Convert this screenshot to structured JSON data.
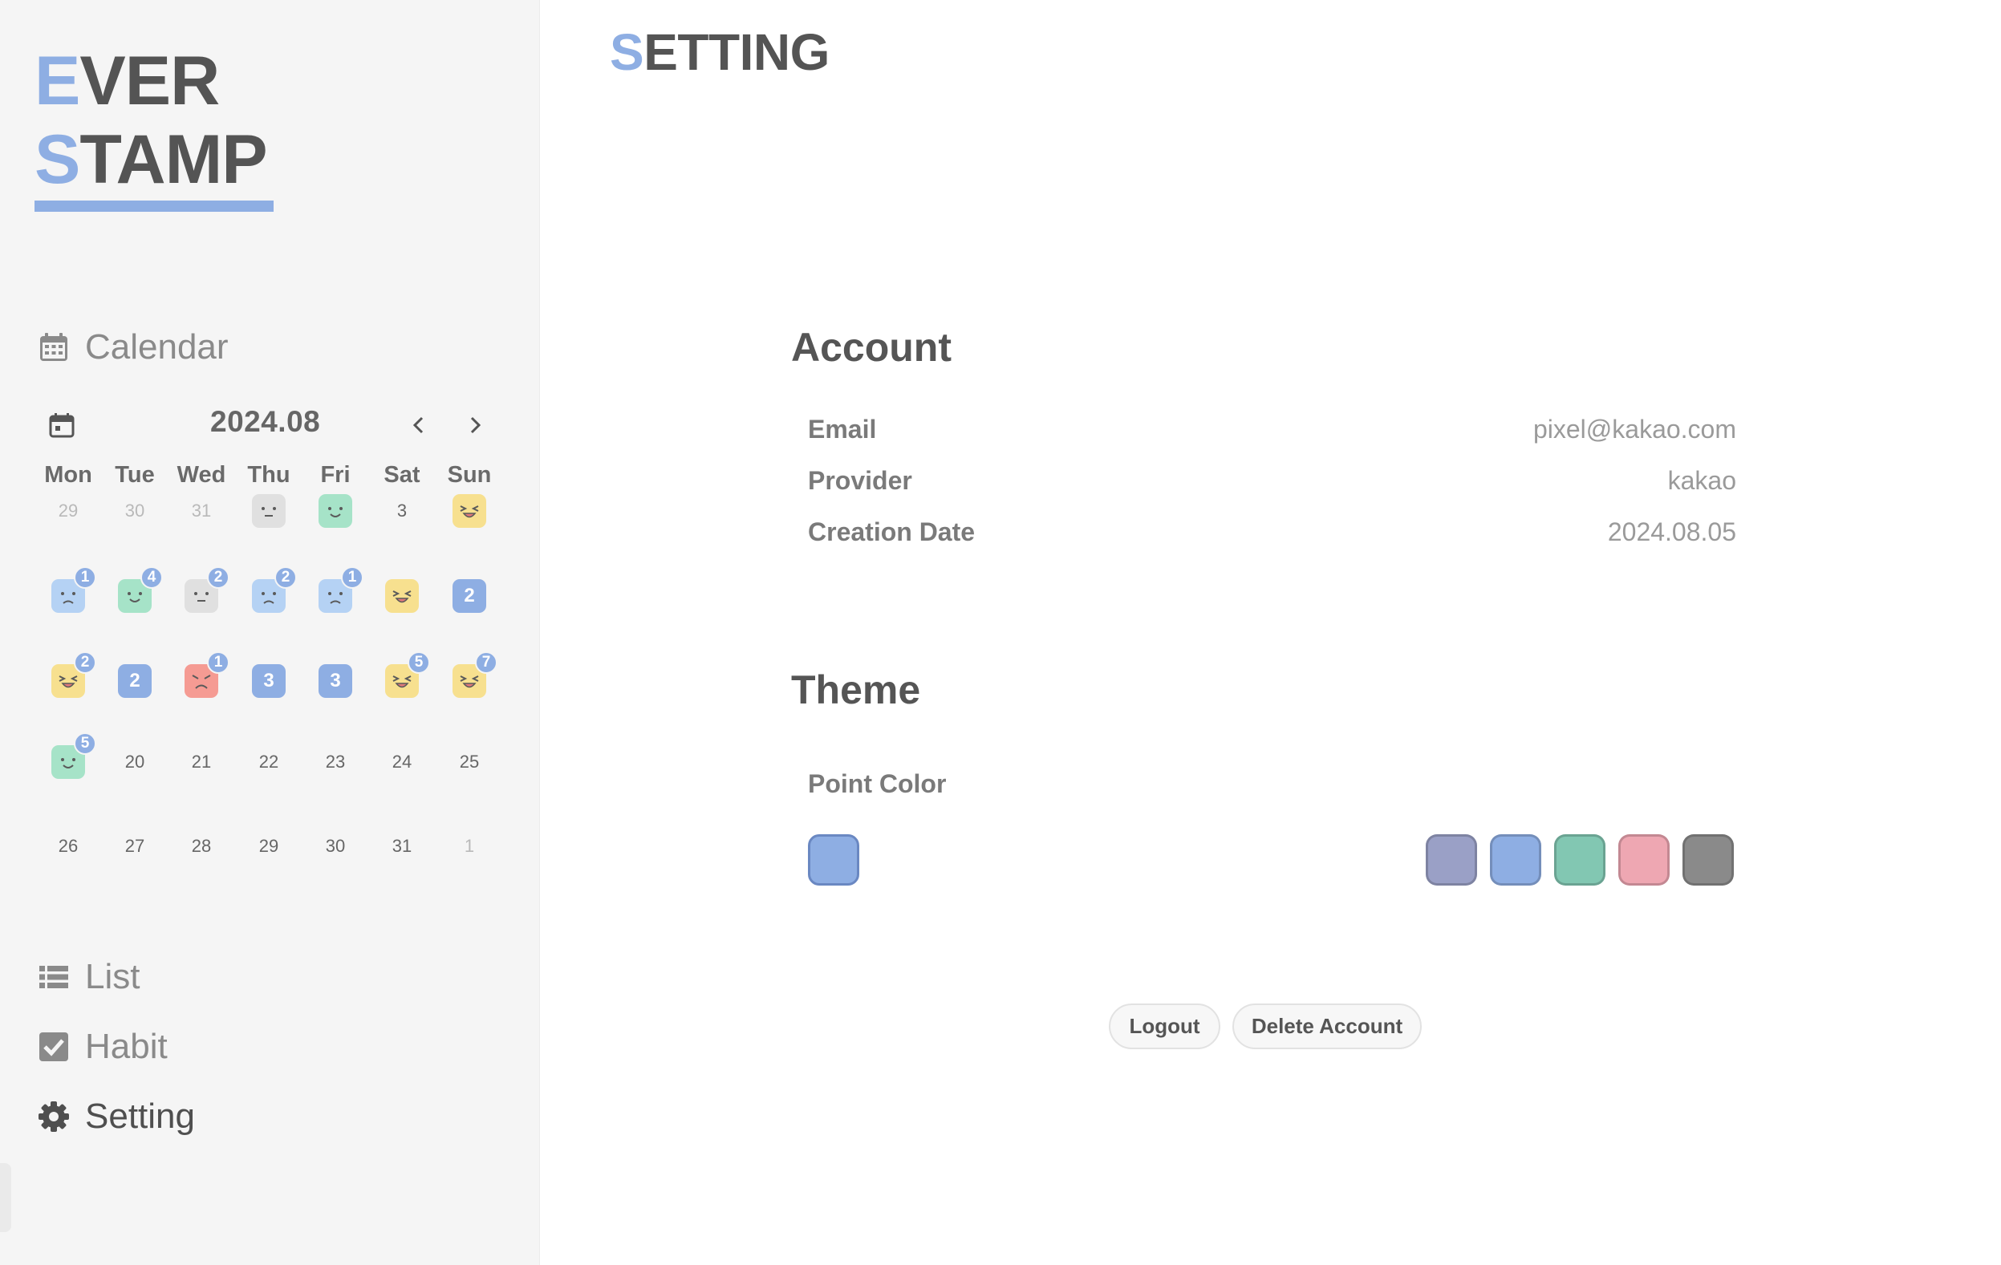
{
  "app": {
    "logo_line1_initial": "E",
    "logo_line1_rest": "VER",
    "logo_line2_initial": "S",
    "logo_line2_rest": "TAMP",
    "accent_color": "#8eaee3"
  },
  "nav": {
    "calendar": {
      "label": "Calendar",
      "icon": "calendar-icon"
    },
    "list": {
      "label": "List",
      "icon": "list-icon"
    },
    "habit": {
      "label": "Habit",
      "icon": "checkbox-icon"
    },
    "setting": {
      "label": "Setting",
      "icon": "gear-icon",
      "active": true
    }
  },
  "calendar": {
    "month": "2024.08",
    "weekdays": [
      "Mon",
      "Tue",
      "Wed",
      "Thu",
      "Fri",
      "Sat",
      "Sun"
    ],
    "weeks": [
      [
        {
          "d": "29",
          "dim": true
        },
        {
          "d": "30",
          "dim": true
        },
        {
          "d": "31",
          "dim": true
        },
        {
          "face": "neutral"
        },
        {
          "face": "happy"
        },
        {
          "d": "3"
        },
        {
          "face": "laugh"
        }
      ],
      [
        {
          "face": "sad",
          "badge": "1"
        },
        {
          "face": "happy",
          "badge": "4"
        },
        {
          "face": "neutral",
          "badge": "2"
        },
        {
          "face": "sad",
          "badge": "2"
        },
        {
          "face": "sad",
          "badge": "1"
        },
        {
          "face": "laugh"
        },
        {
          "count": "2"
        }
      ],
      [
        {
          "face": "laugh",
          "badge": "2"
        },
        {
          "count": "2"
        },
        {
          "face": "angry",
          "badge": "1"
        },
        {
          "count": "3"
        },
        {
          "count": "3"
        },
        {
          "face": "laugh",
          "badge": "5"
        },
        {
          "face": "laugh",
          "badge": "7"
        }
      ],
      [
        {
          "face": "happy",
          "badge": "5"
        },
        {
          "d": "20"
        },
        {
          "d": "21"
        },
        {
          "d": "22"
        },
        {
          "d": "23"
        },
        {
          "d": "24"
        },
        {
          "d": "25"
        }
      ],
      [
        {
          "d": "26"
        },
        {
          "d": "27"
        },
        {
          "d": "28"
        },
        {
          "d": "29"
        },
        {
          "d": "30"
        },
        {
          "d": "31"
        },
        {
          "d": "1",
          "dim": true
        }
      ]
    ],
    "face_colors": {
      "neutral": "#e0e0e0",
      "happy": "#a6e3c8",
      "laugh": "#f7e08f",
      "sad": "#b5d2f4",
      "angry": "#f59b93"
    }
  },
  "page": {
    "title_initial": "S",
    "title_rest": "ETTING"
  },
  "account": {
    "title": "Account",
    "rows": [
      {
        "label": "Email",
        "value": "pixel@kakao.com"
      },
      {
        "label": "Provider",
        "value": "kakao"
      },
      {
        "label": "Creation Date",
        "value": "2024.08.05"
      }
    ]
  },
  "theme": {
    "title": "Theme",
    "point_color_label": "Point Color",
    "selected_color": "#8eaee3",
    "options": [
      "#9aa0c6",
      "#8eaee3",
      "#82c7b2",
      "#eea7b2",
      "#8a8a8a"
    ]
  },
  "actions": {
    "logout": "Logout",
    "delete_account": "Delete Account"
  }
}
